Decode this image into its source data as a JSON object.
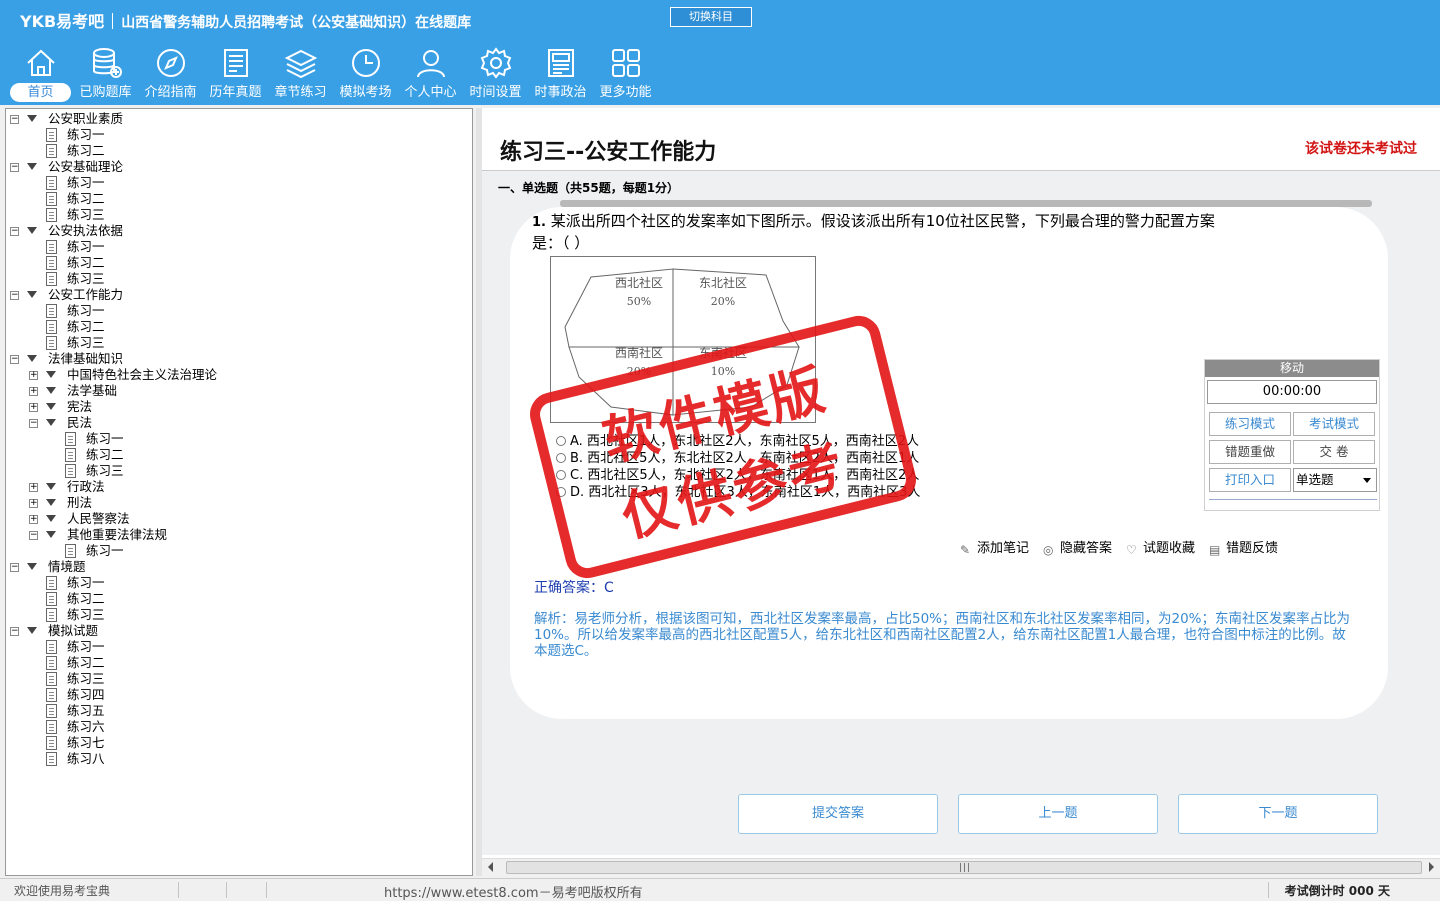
{
  "app": {
    "logo": "YKB易考吧",
    "title": "山西省警务辅助人员招聘考试（公安基础知识）在线题库",
    "switch_subject": "切换科目"
  },
  "toolbar": [
    {
      "label": "首页",
      "icon": "home-icon"
    },
    {
      "label": "已购题库",
      "icon": "database-icon"
    },
    {
      "label": "介绍指南",
      "icon": "compass-icon"
    },
    {
      "label": "历年真题",
      "icon": "document-list-icon"
    },
    {
      "label": "章节练习",
      "icon": "layers-icon"
    },
    {
      "label": "模拟考场",
      "icon": "clock-icon"
    },
    {
      "label": "个人中心",
      "icon": "user-icon"
    },
    {
      "label": "时间设置",
      "icon": "gear-icon"
    },
    {
      "label": "时事政治",
      "icon": "newspaper-icon"
    },
    {
      "label": "更多功能",
      "icon": "grid-icon"
    }
  ],
  "tree": [
    {
      "level": 0,
      "type": "folder",
      "label": "公安职业素质"
    },
    {
      "level": 1,
      "type": "doc",
      "label": "练习一"
    },
    {
      "level": 1,
      "type": "doc",
      "label": "练习二"
    },
    {
      "level": 0,
      "type": "folder",
      "label": "公安基础理论"
    },
    {
      "level": 1,
      "type": "doc",
      "label": "练习一"
    },
    {
      "level": 1,
      "type": "doc",
      "label": "练习二"
    },
    {
      "level": 1,
      "type": "doc",
      "label": "练习三"
    },
    {
      "level": 0,
      "type": "folder",
      "label": "公安执法依据"
    },
    {
      "level": 1,
      "type": "doc",
      "label": "练习一"
    },
    {
      "level": 1,
      "type": "doc",
      "label": "练习二"
    },
    {
      "level": 1,
      "type": "doc",
      "label": "练习三"
    },
    {
      "level": 0,
      "type": "folder",
      "label": "公安工作能力"
    },
    {
      "level": 1,
      "type": "doc",
      "label": "练习一"
    },
    {
      "level": 1,
      "type": "doc",
      "label": "练习二"
    },
    {
      "level": 1,
      "type": "doc",
      "label": "练习三",
      "selected": true
    },
    {
      "level": 0,
      "type": "folder",
      "label": "法律基础知识"
    },
    {
      "level": 1,
      "type": "closed",
      "label": "中国特色社会主义法治理论"
    },
    {
      "level": 1,
      "type": "closed",
      "label": "法学基础"
    },
    {
      "level": 1,
      "type": "closed",
      "label": "宪法"
    },
    {
      "level": 1,
      "type": "open",
      "label": "民法"
    },
    {
      "level": 2,
      "type": "doc",
      "label": "练习一"
    },
    {
      "level": 2,
      "type": "doc",
      "label": "练习二"
    },
    {
      "level": 2,
      "type": "doc",
      "label": "练习三"
    },
    {
      "level": 1,
      "type": "closed",
      "label": "行政法"
    },
    {
      "level": 1,
      "type": "closed",
      "label": "刑法"
    },
    {
      "level": 1,
      "type": "closed",
      "label": "人民警察法"
    },
    {
      "level": 1,
      "type": "open",
      "label": "其他重要法律法规"
    },
    {
      "level": 2,
      "type": "doc",
      "label": "练习一"
    },
    {
      "level": 0,
      "type": "folder",
      "label": "情境题"
    },
    {
      "level": 1,
      "type": "doc",
      "label": "练习一"
    },
    {
      "level": 1,
      "type": "doc",
      "label": "练习二"
    },
    {
      "level": 1,
      "type": "doc",
      "label": "练习三"
    },
    {
      "level": 0,
      "type": "folder",
      "label": "模拟试题"
    },
    {
      "level": 1,
      "type": "doc",
      "label": "练习一"
    },
    {
      "level": 1,
      "type": "doc",
      "label": "练习二"
    },
    {
      "level": 1,
      "type": "doc",
      "label": "练习三"
    },
    {
      "level": 1,
      "type": "doc",
      "label": "练习四"
    },
    {
      "level": 1,
      "type": "doc",
      "label": "练习五"
    },
    {
      "level": 1,
      "type": "doc",
      "label": "练习六"
    },
    {
      "level": 1,
      "type": "doc",
      "label": "练习七"
    },
    {
      "level": 1,
      "type": "doc",
      "label": "练习八"
    }
  ],
  "paper": {
    "title": "练习三--公安工作能力",
    "status": "该试卷还未考试过",
    "section": "一、单选题（共55题，每题1分）"
  },
  "question": {
    "number": "1.",
    "text": "某派出所四个社区的发案率如下图所示。假设该派出所有10位社区民警，下列最合理的警力配置方案是：（  ）",
    "figure": [
      {
        "name": "西北社区",
        "pct": "50%"
      },
      {
        "name": "东北社区",
        "pct": "20%"
      },
      {
        "name": "西南社区",
        "pct": "20%"
      },
      {
        "name": "东南社区",
        "pct": "10%"
      }
    ],
    "options": [
      "A. 西北社区1人，东北社区2人，东南社区5人，西南社区2人",
      "B. 西北社区5人，东北社区2人，东南社区2人，西南社区1人",
      "C. 西北社区5人，东北社区2人，东南社区1人，西南社区2人",
      "D. 西北社区3人，东北社区3人，东南社区1人，西南社区3人"
    ]
  },
  "actions": [
    {
      "label": "添加笔记",
      "icon": "pencil-icon"
    },
    {
      "label": "隐藏答案",
      "icon": "eye-icon"
    },
    {
      "label": "试题收藏",
      "icon": "heart-icon"
    },
    {
      "label": "错题反馈",
      "icon": "feedback-icon"
    }
  ],
  "answer": "正确答案：C",
  "analysis": "解析：易老师分析，根据该图可知，西北社区发案率最高，占比50%；西南社区和东北社区发案率相同，为20%；东南社区发案率占比为10%。所以给发案率最高的西北社区配置5人，给东北社区和西南社区配置2人，给东南社区配置1人最合理，也符合图中标注的比例。故本题选C。",
  "timer": {
    "header": "移动",
    "time": "00:00:00",
    "practice_mode": "练习模式",
    "exam_mode": "考试模式",
    "redo_wrong": "错题重做",
    "submit_paper": "交  卷",
    "print": "打印入口",
    "question_type": "单选题"
  },
  "nav": {
    "submit": "提交答案",
    "prev": "上一题",
    "next": "下一题"
  },
  "watermark": {
    "line1": "软件模版",
    "line2": "仅供参考"
  },
  "statusbar": {
    "welcome": "欢迎使用易考宝典",
    "copyright": "https://www.etest8.com－易考吧版权所有",
    "countdown": "考试倒计时 000 天"
  },
  "colors": {
    "header_bg": "#3aa0e6",
    "stamp": "#e21414",
    "status_red": "#d21414",
    "analysis_blue": "#3a8ad0"
  }
}
